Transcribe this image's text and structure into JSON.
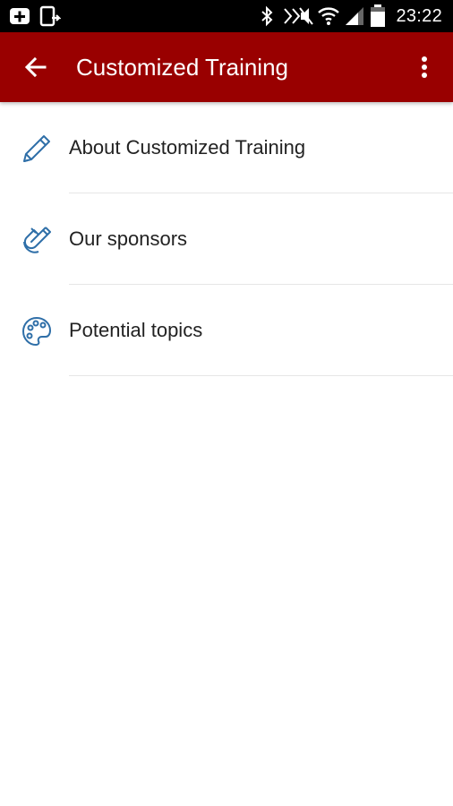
{
  "status_bar": {
    "time": "23:22",
    "icons": [
      "plus-box-icon",
      "screen-share-icon",
      "bluetooth-icon",
      "mute-icon",
      "wifi-icon",
      "signal-icon",
      "battery-icon"
    ]
  },
  "app_bar": {
    "title": "Customized Training",
    "background_color": "#990000",
    "back_icon": "arrow-back-icon",
    "overflow_icon": "more-vert-icon"
  },
  "menu": {
    "icon_color": "#2f6fa8",
    "items": [
      {
        "label": "About Customized Training",
        "icon": "pencil-icon"
      },
      {
        "label": "Our sponsors",
        "icon": "magnet-icon"
      },
      {
        "label": "Potential topics",
        "icon": "palette-icon"
      }
    ]
  }
}
